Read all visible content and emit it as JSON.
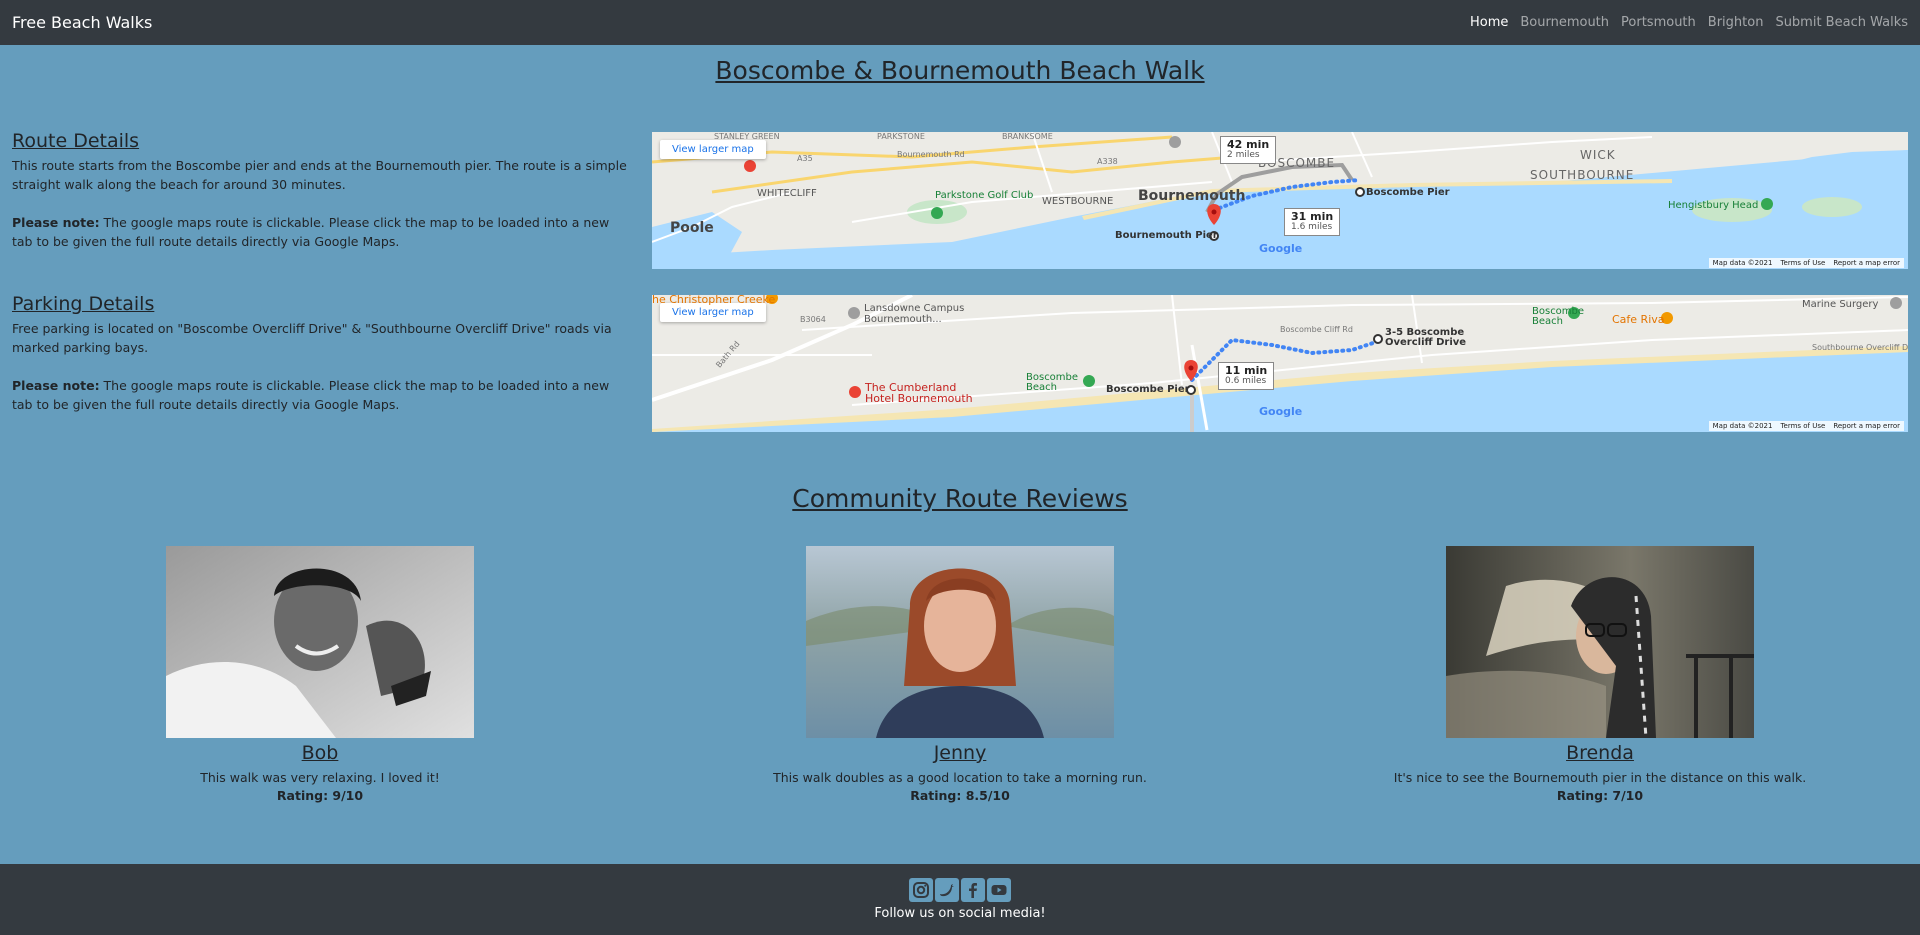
{
  "nav": {
    "brand": "Free Beach Walks",
    "links": [
      {
        "label": "Home",
        "active": true
      },
      {
        "label": "Bournemouth",
        "active": false
      },
      {
        "label": "Portsmouth",
        "active": false
      },
      {
        "label": "Brighton",
        "active": false
      },
      {
        "label": "Submit Beach Walks",
        "active": false
      }
    ]
  },
  "page_title": "Boscombe & Bournemouth Beach Walk",
  "route": {
    "title": "Route Details",
    "text": "This route starts from the Boscombe pier and ends at the Bournemouth pier. The route is a simple straight walk along the beach for around 30 minutes.",
    "note_label": "Please note:",
    "note_text": " The google maps route is clickable. Please click the map to be loaded into a new tab to be given the full route details directly via Google Maps."
  },
  "parking": {
    "title": "Parking Details",
    "text": "Free parking is located on \"Boscombe Overcliff Drive\" & \"Southbourne Overcliff Drive\" roads via marked parking bays.",
    "note_label": "Please note:",
    "note_text": " The google maps route is clickable. Please click the map to be loaded into a new tab to be given the full route details directly via Google Maps."
  },
  "route_map": {
    "larger_map": "View larger map",
    "labels": {
      "stanley_green": "STANLEY GREEN",
      "parkstone": "PARKSTONE",
      "branksome": "BRANKSOME",
      "whitecliff": "WHITECLIFF",
      "parkstone_golf": "Parkstone Golf Club",
      "westbourne": "WESTBOURNE",
      "bournemouth": "Bournemouth",
      "boscombe": "BOSCOMBE",
      "southbourne": "SOUTHBOURNE",
      "wick": "WICK",
      "poole": "Poole",
      "hengistbury": "Hengistbury Head",
      "boscombe_pier": "Boscombe Pier",
      "bournemouth_pier": "Bournemouth Pier",
      "a35": "A35",
      "a338": "A338",
      "bournemouth_rd": "Bournemouth Rd"
    },
    "callout_walk1": {
      "time": "42 min",
      "dist": "2 miles"
    },
    "callout_walk2": {
      "time": "31 min",
      "dist": "1.6 miles"
    },
    "google": "Google",
    "footer": {
      "data": "Map data ©2021",
      "terms": "Terms of Use",
      "report": "Report a map error"
    }
  },
  "parking_map": {
    "larger_map": "View larger map",
    "labels": {
      "christopher_creeke": "he Christopher Creeke",
      "b3064": "B3064",
      "lansdowne": "Lansdowne Campus Bournemouth...",
      "cumberland": "The Cumberland Hotel Bournemouth",
      "boscombe_beach_1": "Boscombe Beach",
      "boscombe_beach_2": "Boscombe Beach",
      "boscombe_pier": "Boscombe Pier",
      "overcliff": "3-5 Boscombe Overcliff Drive",
      "marine_surgery": "Marine Surgery",
      "cafe_riva": "Cafe Riva",
      "bath_rd": "Bath Rd",
      "boscombe_cliff_rd": "Boscombe Cliff Rd",
      "southbourne_overcliff": "Southbourne Overcliff Dr"
    },
    "callout_walk": {
      "time": "11 min",
      "dist": "0.6 miles"
    },
    "google": "Google",
    "footer": {
      "data": "Map data ©2021",
      "terms": "Terms of Use",
      "report": "Report a map error"
    }
  },
  "reviews_title": "Community Route Reviews",
  "reviews": [
    {
      "name": "Bob",
      "comment": "This walk was very relaxing. I loved it!",
      "rating": "Rating: 9/10"
    },
    {
      "name": "Jenny",
      "comment": "This walk doubles as a good location to take a morning run.",
      "rating": "Rating: 8.5/10"
    },
    {
      "name": "Brenda",
      "comment": "It's nice to see the Bournemouth pier in the distance on this walk.",
      "rating": "Rating: 7/10"
    }
  ],
  "footer": {
    "text": "Follow us on social media!",
    "icons": [
      "instagram-icon",
      "twitter-icon",
      "facebook-icon",
      "youtube-icon"
    ]
  },
  "colors": {
    "page_bg": "#659dbd",
    "navbar_bg": "#343a40",
    "sea": "#aadaff",
    "route_blue": "#4285f4"
  }
}
